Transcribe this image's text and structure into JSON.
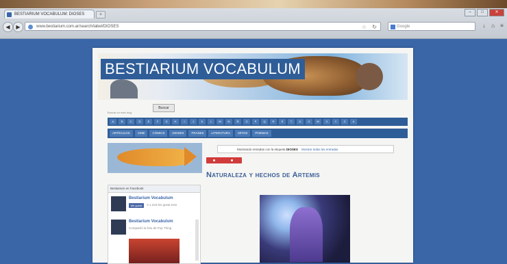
{
  "browser": {
    "tab_title": "BESTIARIUM VOCABULUM: DIOSES",
    "new_tab_label": "+",
    "url": "www.bestiarium.com.ar/search/label/DIOSES",
    "search_placeholder": "Google",
    "win_min": "–",
    "win_max": "□",
    "win_close": "✕",
    "back": "◀",
    "forward": "▶",
    "star": "☆",
    "reload": "↻",
    "download_icon": "↓",
    "home_icon": "⌂",
    "menu_icon": "≡"
  },
  "blog": {
    "title": "BESTIARIUM VOCABULUM",
    "search_label": "Buscar en este blog",
    "search_button": "Buscar",
    "alphabet": [
      "A",
      "B",
      "C",
      "D",
      "E",
      "F",
      "G",
      "H",
      "I",
      "J",
      "K",
      "L",
      "M",
      "N",
      "Ñ",
      "O",
      "P",
      "Q",
      "R",
      "S",
      "T",
      "U",
      "V",
      "W",
      "X",
      "Y",
      "Z",
      "#"
    ],
    "menu": [
      "ARTÍCULOS",
      "CINE",
      "CÓMICS",
      "DIOSES",
      "FRASES",
      "LITERATURA",
      "MITOS",
      "POEMAS"
    ],
    "tag_note": {
      "text": "Mostrando entradas con la etiqueta",
      "tag": "DIOSES",
      "link": "Mostrar todas las entradas"
    },
    "post_title": "Naturaleza y hechos de Artemis",
    "widget": {
      "header": "Bestiarium en Facebook",
      "entries": [
        {
          "name": "Bestiarium Vocabulum",
          "like": "Me gusta",
          "sub": "A 1.234 les gusta esto"
        },
        {
          "name": "Bestiarium Vocabulum",
          "sub": "Compartió la foto de Pop Thing"
        }
      ]
    }
  }
}
